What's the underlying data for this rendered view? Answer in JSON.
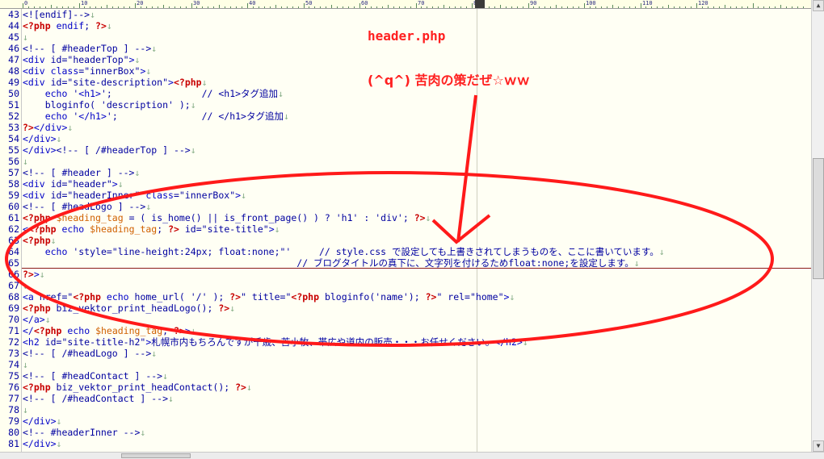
{
  "editor": {
    "ruler_numbers": [
      "0",
      "10",
      "20",
      "30",
      "40",
      "50",
      "60",
      "70",
      "80",
      "90",
      "100",
      "110",
      "120"
    ],
    "lines": [
      {
        "n": "43",
        "html": "<span class=\"cmt\">&lt;![endif]--&gt;</span>"
      },
      {
        "n": "44",
        "html": "<span class=\"php\">&lt;?php</span> <span class=\"k\">endif</span>; <span class=\"php\">?&gt;</span>"
      },
      {
        "n": "45",
        "html": ""
      },
      {
        "n": "46",
        "html": "<span class=\"cmt\">&lt;!-- [ #headerTop ] --&gt;</span>"
      },
      {
        "n": "47",
        "html": "<span class=\"k\">&lt;div</span> id=\"headerTop\"<span class=\"k\">&gt;</span>"
      },
      {
        "n": "48",
        "html": "<span class=\"k\">&lt;div</span> <span class=\"k\">class</span>=\"innerBox\"<span class=\"k\">&gt;</span>"
      },
      {
        "n": "49",
        "html": "<span class=\"k\">&lt;div</span> id=\"site-description\"<span class=\"k\">&gt;</span><span class=\"php\">&lt;?php</span>"
      },
      {
        "n": "50",
        "html": "    <span class=\"k\">echo</span> '<span class=\"k\">&lt;h1&gt;</span>';                <span class=\"jp-cmt\">// &lt;h1&gt;タグ追加</span>"
      },
      {
        "n": "51",
        "html": "    bloginfo( 'description' );"
      },
      {
        "n": "52",
        "html": "    <span class=\"k\">echo</span> '<span class=\"k\">&lt;/h1&gt;</span>';               <span class=\"jp-cmt\">// &lt;/h1&gt;タグ追加</span>"
      },
      {
        "n": "53",
        "html": "<span class=\"php\">?&gt;</span><span class=\"k\">&lt;/div&gt;</span>"
      },
      {
        "n": "54",
        "html": "<span class=\"k\">&lt;/div&gt;</span>"
      },
      {
        "n": "55",
        "html": "<span class=\"k\">&lt;/div&gt;</span><span class=\"cmt\">&lt;!-- [ /#headerTop ] --&gt;</span>"
      },
      {
        "n": "56",
        "html": ""
      },
      {
        "n": "57",
        "html": "<span class=\"cmt\">&lt;!-- [ #header ] --&gt;</span>"
      },
      {
        "n": "58",
        "html": "<span class=\"k\">&lt;div</span> id=\"header\"<span class=\"k\">&gt;</span>"
      },
      {
        "n": "59",
        "html": "<span class=\"k\">&lt;div</span> id=\"headerInner\" <span class=\"k\">class</span>=\"innerBox\"<span class=\"k\">&gt;</span>"
      },
      {
        "n": "60",
        "html": "<span class=\"cmt\">&lt;!-- [ #headLogo ] --&gt;</span>"
      },
      {
        "n": "61",
        "html": "<span class=\"php\">&lt;?php</span> <span class=\"var\">$heading_tag</span> = ( is_home() || is_front_page() ) ? 'h1' : 'div'; <span class=\"php\">?&gt;</span>"
      },
      {
        "n": "62",
        "html": "<span class=\"k\">&lt;</span><span class=\"php\">&lt;?php</span> <span class=\"k\">echo</span> <span class=\"var\">$heading_tag</span>; <span class=\"php\">?&gt;</span> id=\"site-title\"<span class=\"k\">&gt;</span>"
      },
      {
        "n": "63",
        "html": "<span class=\"php\">&lt;?php</span>"
      },
      {
        "n": "64",
        "html": "    <span class=\"k\">echo</span> 'style=\"line-height:24px; float:none;\"'     <span class=\"jp-cmt\">// style.css で設定しても上書きされてしまうものを、ここに書いています。</span>"
      },
      {
        "n": "65",
        "html": "                                                 <span class=\"jp-cmt\">// ブログタイトルの真下に、文字列を付けるためfloat:none;を設定します。</span>"
      },
      {
        "n": "66",
        "html": "<span class=\"php\">?&gt;</span><span class=\"k\">&gt;</span>"
      },
      {
        "n": "67",
        "html": ""
      },
      {
        "n": "68",
        "html": "<span class=\"k\">&lt;a</span> href=\"<span class=\"php\">&lt;?php</span> <span class=\"k\">echo</span> home_url( '/' ); <span class=\"php\">?&gt;</span>\" title=\"<span class=\"php\">&lt;?php</span> bloginfo('name'); <span class=\"php\">?&gt;</span>\" rel=\"home\"<span class=\"k\">&gt;</span>"
      },
      {
        "n": "69",
        "html": "<span class=\"php\">&lt;?php</span> biz_vektor_print_headLogo(); <span class=\"php\">?&gt;</span>"
      },
      {
        "n": "70",
        "html": "<span class=\"k\">&lt;/a&gt;</span>"
      },
      {
        "n": "71",
        "html": "<span class=\"k\">&lt;/</span><span class=\"php\">&lt;?php</span> <span class=\"k\">echo</span> <span class=\"var\">$heading_tag</span>; <span class=\"php\">?&gt;</span><span class=\"k\">&gt;</span>"
      },
      {
        "n": "72",
        "html": "<span class=\"k\">&lt;h2</span> id=\"site-title-h2\"<span class=\"k\">&gt;</span>札幌市内もちろんですが千歳、苫小牧、帯広や道内の販売・・・お任せください。<span class=\"k\">&lt;/h2&gt;</span>"
      },
      {
        "n": "73",
        "html": "<span class=\"cmt\">&lt;!-- [ /#headLogo ] --&gt;</span>"
      },
      {
        "n": "74",
        "html": ""
      },
      {
        "n": "75",
        "html": "<span class=\"cmt\">&lt;!-- [ #headContact ] --&gt;</span>"
      },
      {
        "n": "76",
        "html": "<span class=\"php\">&lt;?php</span> biz_vektor_print_headContact(); <span class=\"php\">?&gt;</span>"
      },
      {
        "n": "77",
        "html": "<span class=\"cmt\">&lt;!-- [ /#headContact ] --&gt;</span>"
      },
      {
        "n": "78",
        "html": ""
      },
      {
        "n": "79",
        "html": "<span class=\"k\">&lt;/div&gt;</span>"
      },
      {
        "n": "80",
        "html": "<span class=\"cmt\">&lt;!-- #headerInner --&gt;</span>"
      },
      {
        "n": "81",
        "html": "<span class=\"k\">&lt;/div&gt;</span>"
      }
    ],
    "cursor_line": "65"
  },
  "annotation": {
    "title": "header.php",
    "subtitle": "(^q^) 苦肉の策だぜ☆ｗｗ",
    "color": "#ff2020"
  },
  "colors": {
    "background": "#fffff4",
    "tag": "#0000c8",
    "php": "#c80000",
    "variable": "#d06000"
  }
}
